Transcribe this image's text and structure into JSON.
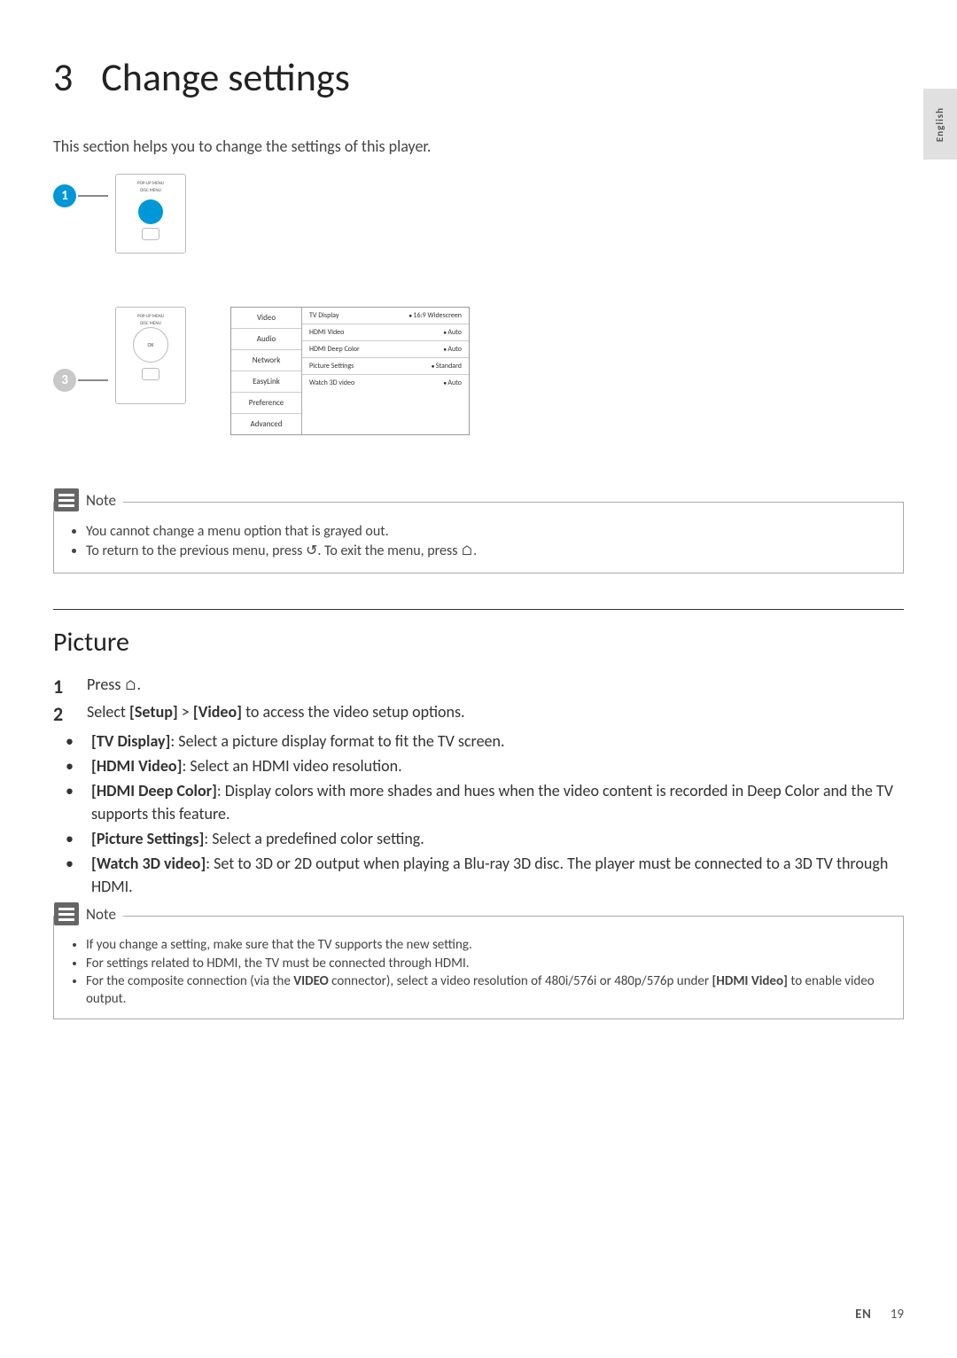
{
  "side_tab": "English",
  "chapter_num": "3",
  "chapter_title": "Change settings",
  "intro": "This section helps you to change the settings of this player.",
  "diagram": {
    "step1_num": "1",
    "step3_num": "3",
    "remote_labels": {
      "popup": "POP-UP\nMENU",
      "disc": "DISC\nMENU"
    },
    "menu_left": [
      "Video",
      "Audio",
      "Network",
      "EasyLink",
      "Preference",
      "Advanced"
    ],
    "menu_right": [
      {
        "label": "TV Display",
        "value": "16:9 Widescreen"
      },
      {
        "label": "HDMI Video",
        "value": "Auto"
      },
      {
        "label": "HDMI Deep Color",
        "value": "Auto"
      },
      {
        "label": "Picture Settings",
        "value": "Standard"
      },
      {
        "label": "Watch 3D video",
        "value": "Auto"
      }
    ]
  },
  "note1": {
    "title": "Note",
    "items": [
      "You cannot change a menu option that is grayed out.",
      "To return to the previous menu, press ↺. To exit the menu, press ⌂."
    ]
  },
  "section_title": "Picture",
  "steps": [
    {
      "num": "1",
      "text": "Press ⌂."
    },
    {
      "num": "2",
      "text": "Select [Setup] > [Video] to access the video setup options."
    }
  ],
  "bullets": [
    {
      "label": "[TV Display]",
      "desc": ": Select a picture display format to fit the TV screen."
    },
    {
      "label": "[HDMI Video]",
      "desc": ": Select an HDMI video resolution."
    },
    {
      "label": "[HDMI Deep Color]",
      "desc": ": Display colors with more shades and hues when the video content is recorded in Deep Color and the TV supports this feature."
    },
    {
      "label": "[Picture Settings]",
      "desc": ": Select a predefined color setting."
    },
    {
      "label": "[Watch 3D video]",
      "desc": ": Set to 3D or 2D output when playing a Blu-ray 3D disc. The player must be connected to a 3D TV through HDMI."
    }
  ],
  "note2": {
    "title": "Note",
    "items": [
      "If you change a setting, make sure that the TV supports the new setting.",
      "For settings related to HDMI, the TV must be connected through HDMI.",
      "For the composite connection (via the VIDEO connector), select a video resolution of 480i/576i or 480p/576p under [HDMI Video] to enable video output."
    ]
  },
  "footer": {
    "lang": "EN",
    "page": "19"
  }
}
